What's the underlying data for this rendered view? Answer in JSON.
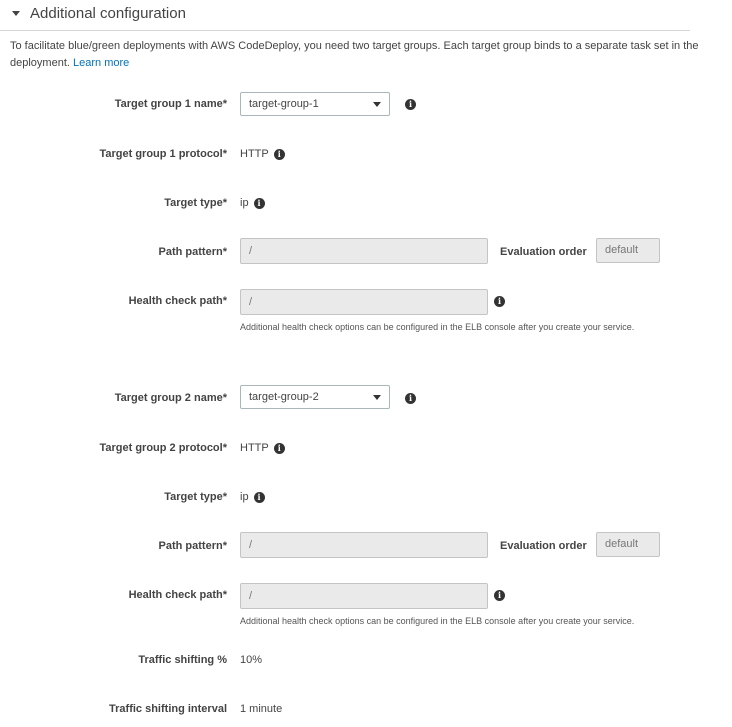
{
  "section": {
    "title": "Additional configuration",
    "intro": "To facilitate blue/green deployments with AWS CodeDeploy, you need two target groups. Each target group binds to a separate task set in the deployment.",
    "learn_more": "Learn more"
  },
  "tg1": {
    "name_label": "Target group 1 name*",
    "name_value": "target-group-1",
    "protocol_label": "Target group 1 protocol*",
    "protocol_value": "HTTP",
    "type_label": "Target type*",
    "type_value": "ip",
    "path_label": "Path pattern*",
    "path_value": "/",
    "eval_label": "Evaluation order",
    "eval_value": "default",
    "health_label": "Health check path*",
    "health_value": "/",
    "health_help": "Additional health check options can be configured in the ELB console after you create your service."
  },
  "tg2": {
    "name_label": "Target group 2 name*",
    "name_value": "target-group-2",
    "protocol_label": "Target group 2 protocol*",
    "protocol_value": "HTTP",
    "type_label": "Target type*",
    "type_value": "ip",
    "path_label": "Path pattern*",
    "path_value": "/",
    "eval_label": "Evaluation order",
    "eval_value": "default",
    "health_label": "Health check path*",
    "health_value": "/",
    "health_help": "Additional health check options can be configured in the ELB console after you create your service."
  },
  "traffic": {
    "pct_label": "Traffic shifting %",
    "pct_value": "10%",
    "interval_label": "Traffic shifting interval",
    "interval_value": "1 minute"
  },
  "icons": {
    "info": "i"
  }
}
